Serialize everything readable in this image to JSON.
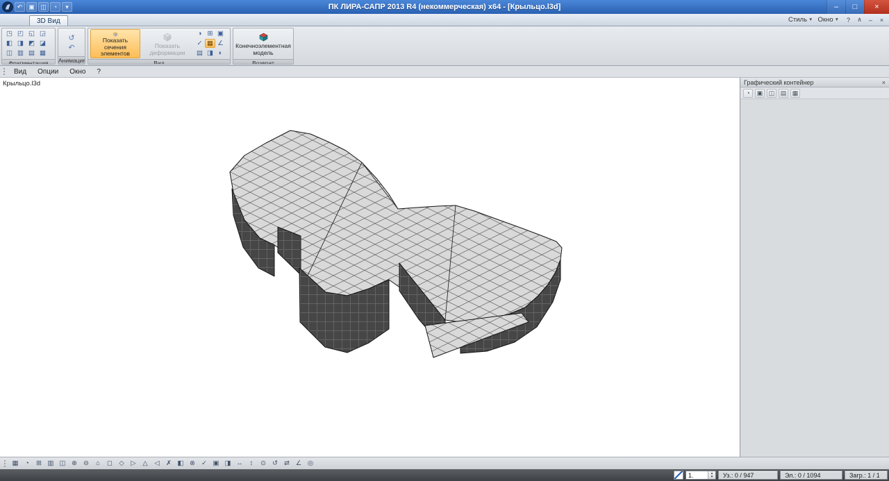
{
  "colors": {
    "titlebar_blue": "#2f6fc9",
    "close_red": "#c63b2a",
    "accent_orange": "#fcb44b",
    "model_top": "#d9d9d9",
    "model_side": "#464646",
    "canvas_bg": "#ffffff"
  },
  "titlebar": {
    "title": "ПК ЛИРА-САПР  2013 R4 (некоммерческая) x64 - [Крыльцо.l3d]",
    "minimize": "–",
    "restore": "□",
    "close": "×",
    "qat_icons": [
      "↶",
      "▣",
      "◫",
      "◔",
      "▾"
    ]
  },
  "ribbon": {
    "tab": "3D Вид",
    "style_label": "Стиль",
    "window_label": "Окно",
    "caret": "▼",
    "right_icons": [
      "?",
      "∧",
      "–",
      "×"
    ],
    "groups": {
      "fragmentation": {
        "label": "Фрагментация",
        "icons": [
          "◳",
          "◰",
          "◱",
          "◲",
          "◧",
          "◨",
          "◩",
          "◪",
          "◫",
          "▥",
          "▤",
          "▦"
        ]
      },
      "animation": {
        "label": "Анимация",
        "icons": [
          "↺",
          "↶"
        ]
      },
      "view": {
        "label": "Вид",
        "show_sections": "Показать сечения элементов",
        "show_deformations": "Показать деформации",
        "small_icons": [
          "◑",
          "✓",
          "▤",
          "⊞",
          "▦",
          "◨",
          "▣",
          "∠",
          "◐"
        ]
      },
      "return": {
        "label": "Возврат",
        "fe_model": "Конечноэлементная модель"
      }
    }
  },
  "menubar": {
    "items": [
      "Вид",
      "Опции",
      "Окно",
      "?"
    ]
  },
  "canvas": {
    "doc_label": "Крыльцо.l3d"
  },
  "right_panel": {
    "title": "Графический контейнер",
    "close": "×",
    "tool_icons": [
      "◔",
      "▣",
      "◫",
      "▤",
      "▦"
    ]
  },
  "bottom_toolbar": {
    "icons": [
      "▦",
      "◔",
      "⊞",
      "▥",
      "◫",
      "⊕",
      "⊖",
      "⌂",
      "◻",
      "◇",
      "▷",
      "△",
      "◁",
      "✗",
      "◧",
      "⊗",
      "✓",
      "▣",
      "◨",
      "↔",
      "↕",
      "⊙",
      "↺",
      "⇄",
      "∠",
      "◎"
    ]
  },
  "statusbar": {
    "selector_value": "1.",
    "spin_up": "▴",
    "spin_down": "▾",
    "nodes": "Уз.: 0 / 947",
    "elements": "Эл.: 0 / 1094",
    "loads": "Загр.: 1 / 1"
  }
}
